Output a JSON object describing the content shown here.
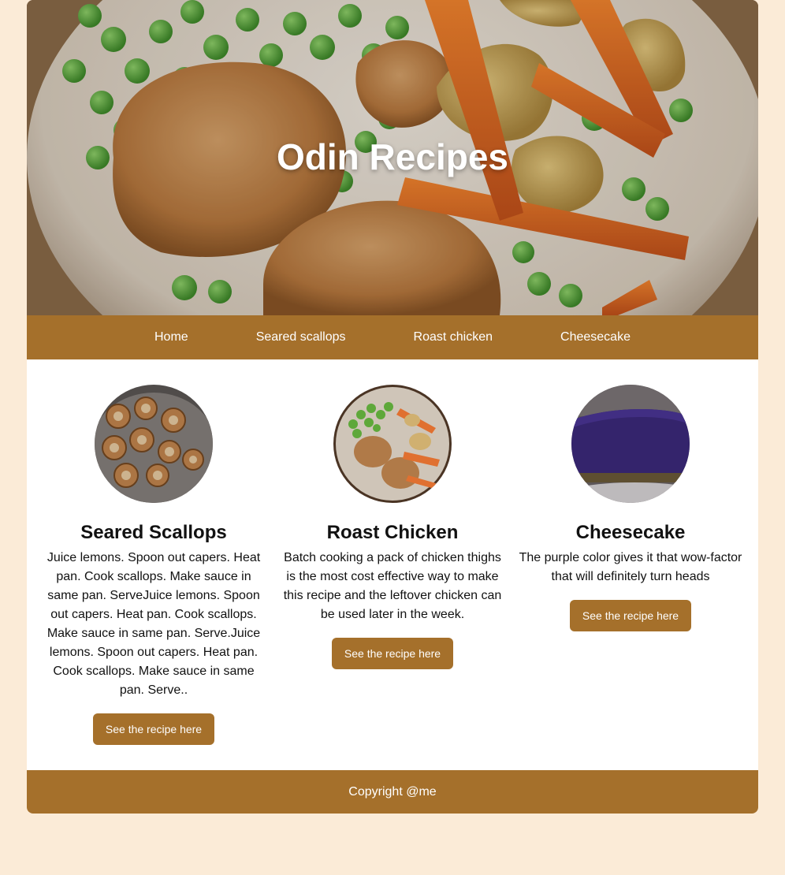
{
  "hero": {
    "title": "Odin Recipes"
  },
  "nav": {
    "items": [
      {
        "label": "Home"
      },
      {
        "label": "Seared scallops"
      },
      {
        "label": "Roast chicken"
      },
      {
        "label": "Cheesecake"
      }
    ]
  },
  "cards": [
    {
      "title": "Seared Scallops",
      "description": "Juice lemons. Spoon out capers. Heat pan. Cook scallops. Make sauce in same pan. ServeJuice lemons. Spoon out capers. Heat pan. Cook scallops. Make sauce in same pan. Serve.Juice lemons. Spoon out capers. Heat pan. Cook scallops. Make sauce in same pan. Serve..",
      "button_label": "See the recipe here"
    },
    {
      "title": "Roast Chicken",
      "description": "Batch cooking a pack of chicken thighs is the most cost effective way to make this recipe and the leftover chicken can be used later in the week.",
      "button_label": "See the recipe here"
    },
    {
      "title": "Cheesecake",
      "description": "The purple color gives it that wow-factor that will definitely turn heads",
      "button_label": "See the recipe here"
    }
  ],
  "footer": {
    "text": "Copyright @me"
  },
  "colors": {
    "background": "#fbebd7",
    "accent": "#a5702b",
    "text": "#111111"
  }
}
